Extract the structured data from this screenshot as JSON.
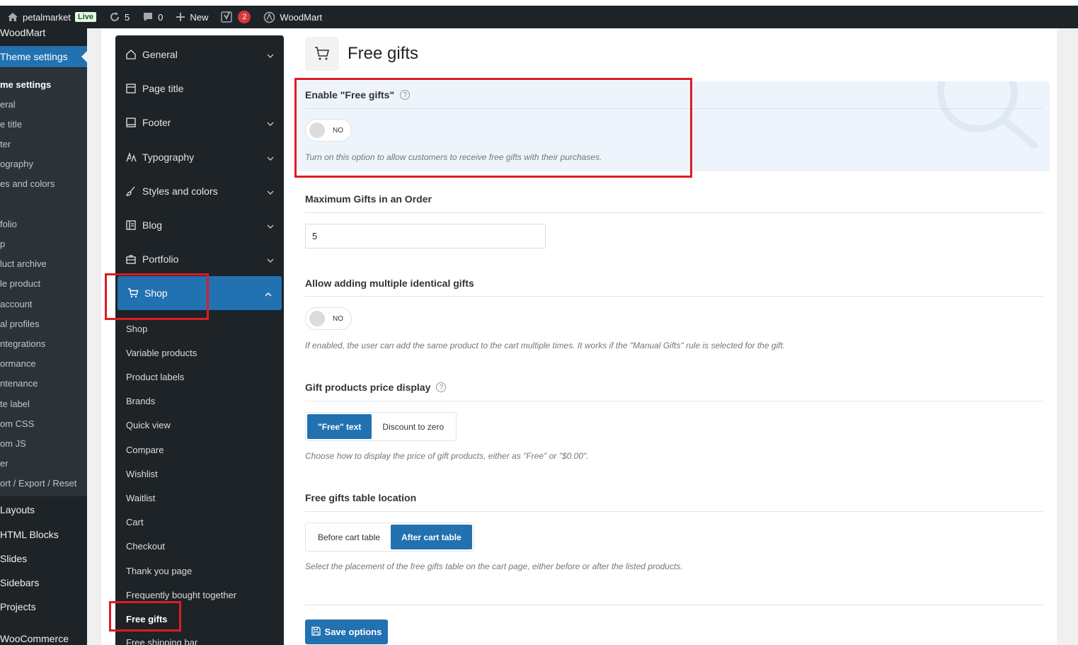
{
  "admin_bar": {
    "site_name": "petalmarket",
    "live_badge": "Live",
    "updates_count": "5",
    "comments_count": "0",
    "new_label": "New",
    "yoast_count": "2",
    "woodmart_label": "WoodMart"
  },
  "wp_menu": {
    "woodmart": "WoodMart",
    "theme_settings": "Theme settings",
    "submenu": [
      "me settings",
      "eral",
      "e title",
      "ter",
      "ography",
      "es and colors",
      "",
      "folio",
      "p",
      "luct archive",
      "le product",
      "account",
      "al profiles",
      "ntegrations",
      "ormance",
      "ntenance",
      "te label",
      "om CSS",
      "om JS",
      "er",
      "ort / Export / Reset"
    ],
    "layouts": "Layouts",
    "html_blocks": "HTML Blocks",
    "slides": "Slides",
    "sidebars": "Sidebars",
    "projects": "Projects",
    "woocommerce": "WooCommerce"
  },
  "settings_nav": {
    "items": [
      {
        "label": "General",
        "icon": "home-icon"
      },
      {
        "label": "Page title",
        "icon": "page-title-icon"
      },
      {
        "label": "Footer",
        "icon": "footer-icon"
      },
      {
        "label": "Typography",
        "icon": "typography-icon"
      },
      {
        "label": "Styles and colors",
        "icon": "brush-icon"
      },
      {
        "label": "Blog",
        "icon": "blog-icon"
      },
      {
        "label": "Portfolio",
        "icon": "briefcase-icon"
      },
      {
        "label": "Shop",
        "icon": "cart-icon"
      }
    ],
    "shop_sub": [
      "Shop",
      "Variable products",
      "Product labels",
      "Brands",
      "Quick view",
      "Compare",
      "Wishlist",
      "Waitlist",
      "Cart",
      "Checkout",
      "Thank you page",
      "Frequently bought together",
      "Free gifts",
      "Free shipping bar"
    ]
  },
  "page": {
    "title": "Free gifts",
    "enable": {
      "title": "Enable \"Free gifts\"",
      "toggle": "NO",
      "desc": "Turn on this option to allow customers to receive free gifts with their purchases."
    },
    "max_gifts": {
      "title": "Maximum Gifts in an Order",
      "value": "5"
    },
    "multiple": {
      "title": "Allow adding multiple identical gifts",
      "toggle": "NO",
      "desc": "If enabled, the user can add the same product to the cart multiple times. It works if the \"Manual Gifts\" rule is selected for the gift."
    },
    "price_display": {
      "title": "Gift products price display",
      "options": [
        "\"Free\" text",
        "Discount to zero"
      ],
      "selected": "\"Free\" text",
      "desc": "Choose how to display the price of gift products, either as \"Free\" or \"$0.00\"."
    },
    "table_location": {
      "title": "Free gifts table location",
      "options": [
        "Before cart table",
        "After cart table"
      ],
      "selected": "After cart table",
      "desc": "Select the placement of the free gifts table on the cart page, either before or after the listed products."
    },
    "save_label": "Save options"
  },
  "colors": {
    "accent": "#2271b1",
    "highlight": "#e01b24",
    "admin_dark": "#1d2327"
  }
}
